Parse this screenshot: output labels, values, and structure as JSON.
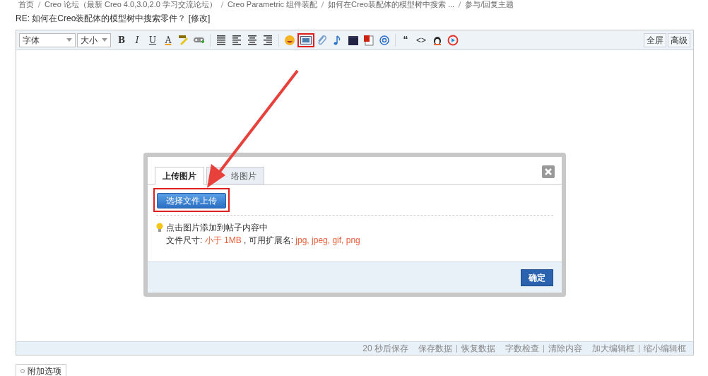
{
  "breadcrumb": [
    "首页",
    "Creo 论坛（最新 Creo 4.0,3.0,2.0 学习交流论坛）",
    "Creo Parametric 组件装配",
    "如何在Creo装配体的模型树中搜索 ...",
    "参与/回复主题"
  ],
  "title": "RE: 如何在Creo装配体的模型树中搜索零件？ [修改]",
  "toolbar": {
    "font_select": "字体",
    "size_select": "大小",
    "format_glyphs": [
      "B",
      "I",
      "U",
      "A"
    ],
    "quote_glyph": "“",
    "code_glyph": "<>",
    "image_button_highlighted": true,
    "right_buttons": [
      "全屏",
      "高级"
    ]
  },
  "dialog": {
    "tabs": [
      {
        "label": "上传图片",
        "selected": true
      },
      {
        "label": "络图片",
        "selected": false
      }
    ],
    "upload_button": {
      "label": "选择文件上传",
      "highlighted": true
    },
    "tip": "点击图片添加到帖子内容中",
    "size_line": [
      {
        "text": "文件尺寸: ",
        "emphasis": false
      },
      {
        "text": "小于 1MB",
        "emphasis": true
      },
      {
        "text": " , 可用扩展名: ",
        "emphasis": false
      },
      {
        "text": "jpg, jpeg, gif, png",
        "emphasis": true
      }
    ],
    "confirm": "确定"
  },
  "status_bar": {
    "autosave": "20 秒后保存",
    "links": [
      [
        "保存数据",
        "恢复数据"
      ],
      [
        "字数检查",
        "清除内容"
      ],
      [
        "加大编辑框",
        "缩小编辑框"
      ]
    ]
  },
  "extra_options": "附加选项"
}
